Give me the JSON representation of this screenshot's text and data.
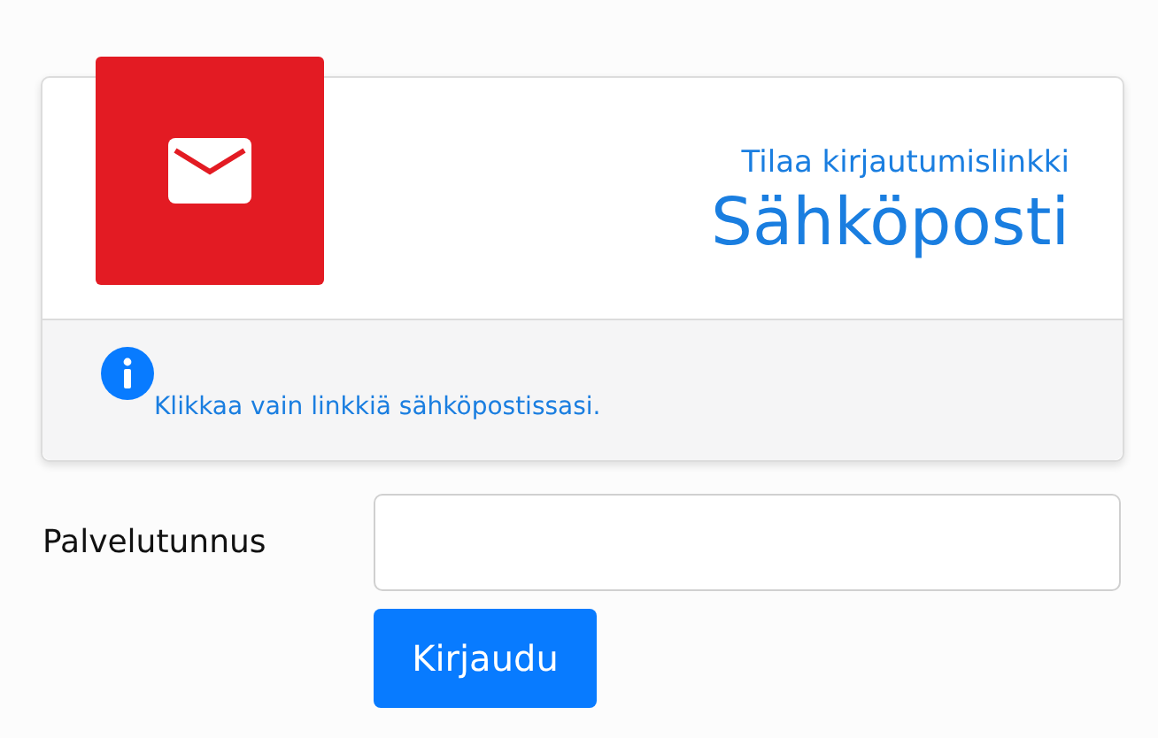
{
  "card": {
    "subtitle": "Tilaa kirjautumislinkki",
    "title": "Sähköposti",
    "info": "Klikkaa vain linkkiä sähköpostissasi."
  },
  "form": {
    "label": "Palvelutunnus",
    "button": "Kirjaudu"
  }
}
